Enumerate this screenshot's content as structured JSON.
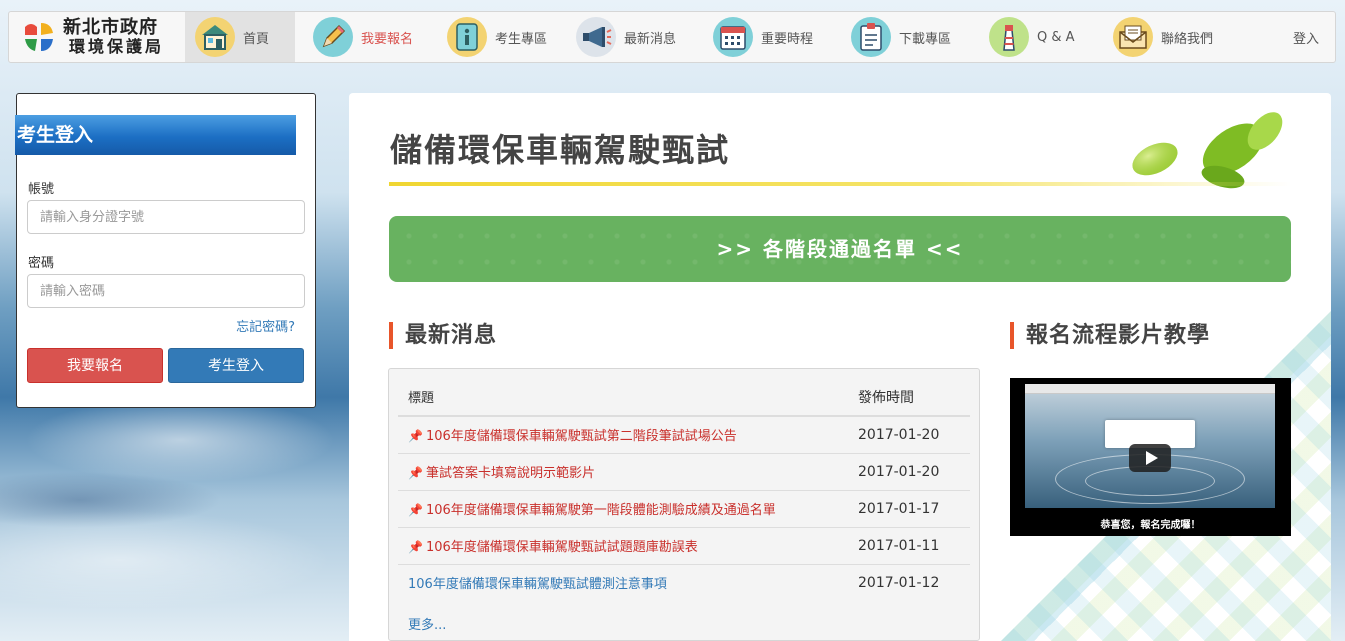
{
  "brand": {
    "line1": "新北市政府",
    "line2": "環境保護局"
  },
  "nav": {
    "items": [
      {
        "label": "首頁",
        "icon": "house-icon"
      },
      {
        "label": "我要報名",
        "icon": "pencil-icon"
      },
      {
        "label": "考生專區",
        "icon": "info-icon"
      },
      {
        "label": "最新消息",
        "icon": "megaphone-icon"
      },
      {
        "label": "重要時程",
        "icon": "calendar-icon"
      },
      {
        "label": "下載專區",
        "icon": "clipboard-icon"
      },
      {
        "label": "Q & A",
        "icon": "lighthouse-icon"
      },
      {
        "label": "聯絡我們",
        "icon": "envelope-icon"
      }
    ],
    "login": "登入"
  },
  "login": {
    "title": "考生登入",
    "account_label": "帳號",
    "account_placeholder": "請輸入身分證字號",
    "password_label": "密碼",
    "password_placeholder": "請輸入密碼",
    "forgot": "忘記密碼?",
    "signup_button": "我要報名",
    "login_button": "考生登入"
  },
  "main": {
    "title": "儲備環保車輛駕駛甄試",
    "banner": ">> 各階段通過名單 <<",
    "news": {
      "section_title": "最新消息",
      "col_title": "標題",
      "col_date": "發佈時間",
      "rows": [
        {
          "title": "106年度儲備環保車輛駕駛甄試第二階段筆試試場公告",
          "date": "2017-01-20",
          "pinned": true
        },
        {
          "title": "筆試答案卡填寫說明示範影片",
          "date": "2017-01-20",
          "pinned": true
        },
        {
          "title": "106年度儲備環保車輛駕駛第一階段體能測驗成績及通過名單",
          "date": "2017-01-17",
          "pinned": true
        },
        {
          "title": "106年度儲備環保車輛駕駛甄試試題題庫勘誤表",
          "date": "2017-01-11",
          "pinned": true
        },
        {
          "title": "106年度儲備環保車輛駕駛甄試體測注意事項",
          "date": "2017-01-12",
          "pinned": false
        }
      ],
      "more": "更多..."
    },
    "video": {
      "section_title": "報名流程影片教學",
      "caption": "恭喜您，報名完成囉！"
    }
  },
  "colors": {
    "accent_red": "#d9534f",
    "accent_blue": "#337ab7",
    "banner_green": "#68b260",
    "title_rule_yellow": "#f0d631",
    "section_bar": "#e8552a"
  }
}
